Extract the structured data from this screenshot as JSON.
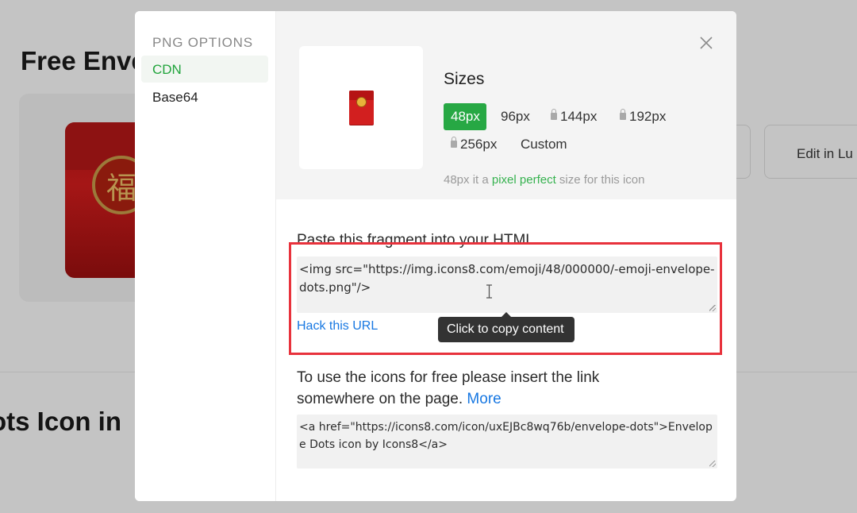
{
  "background": {
    "title": "Free Enve",
    "subtitle": "ots Icon in",
    "edit_button": "Edit in Lu"
  },
  "modal": {
    "sidebar": {
      "heading": "PNG OPTIONS",
      "items": [
        {
          "label": "CDN",
          "active": true
        },
        {
          "label": "Base64",
          "active": false
        }
      ]
    },
    "sizes": {
      "title": "Sizes",
      "options": [
        {
          "label": "48px",
          "active": true,
          "locked": false
        },
        {
          "label": "96px",
          "active": false,
          "locked": false
        },
        {
          "label": "144px",
          "active": false,
          "locked": true
        },
        {
          "label": "192px",
          "active": false,
          "locked": true
        },
        {
          "label": "256px",
          "active": false,
          "locked": true
        },
        {
          "label": "Custom",
          "active": false,
          "locked": false
        }
      ],
      "hint_prefix": "48px it a ",
      "hint_highlight": "pixel perfect",
      "hint_suffix": " size for this icon"
    },
    "html_fragment": {
      "label": "Paste this fragment into your HTML",
      "code": "<img src=\"https://img.icons8.com/emoji/48/000000/-emoji-envelope-dots.png\"/>",
      "hack_link": "Hack this URL",
      "tooltip": "Click to copy content"
    },
    "attribution": {
      "text": "To use the icons for free please insert the link somewhere on the page. ",
      "more_link": "More",
      "code": "<a href=\"https://icons8.com/icon/uxEJBc8wq76b/envelope-dots\">Envelope Dots icon by Icons8</a>"
    }
  },
  "colors": {
    "accent_green": "#27a844",
    "link_blue": "#1878e2",
    "highlight_red": "#e8323c"
  }
}
